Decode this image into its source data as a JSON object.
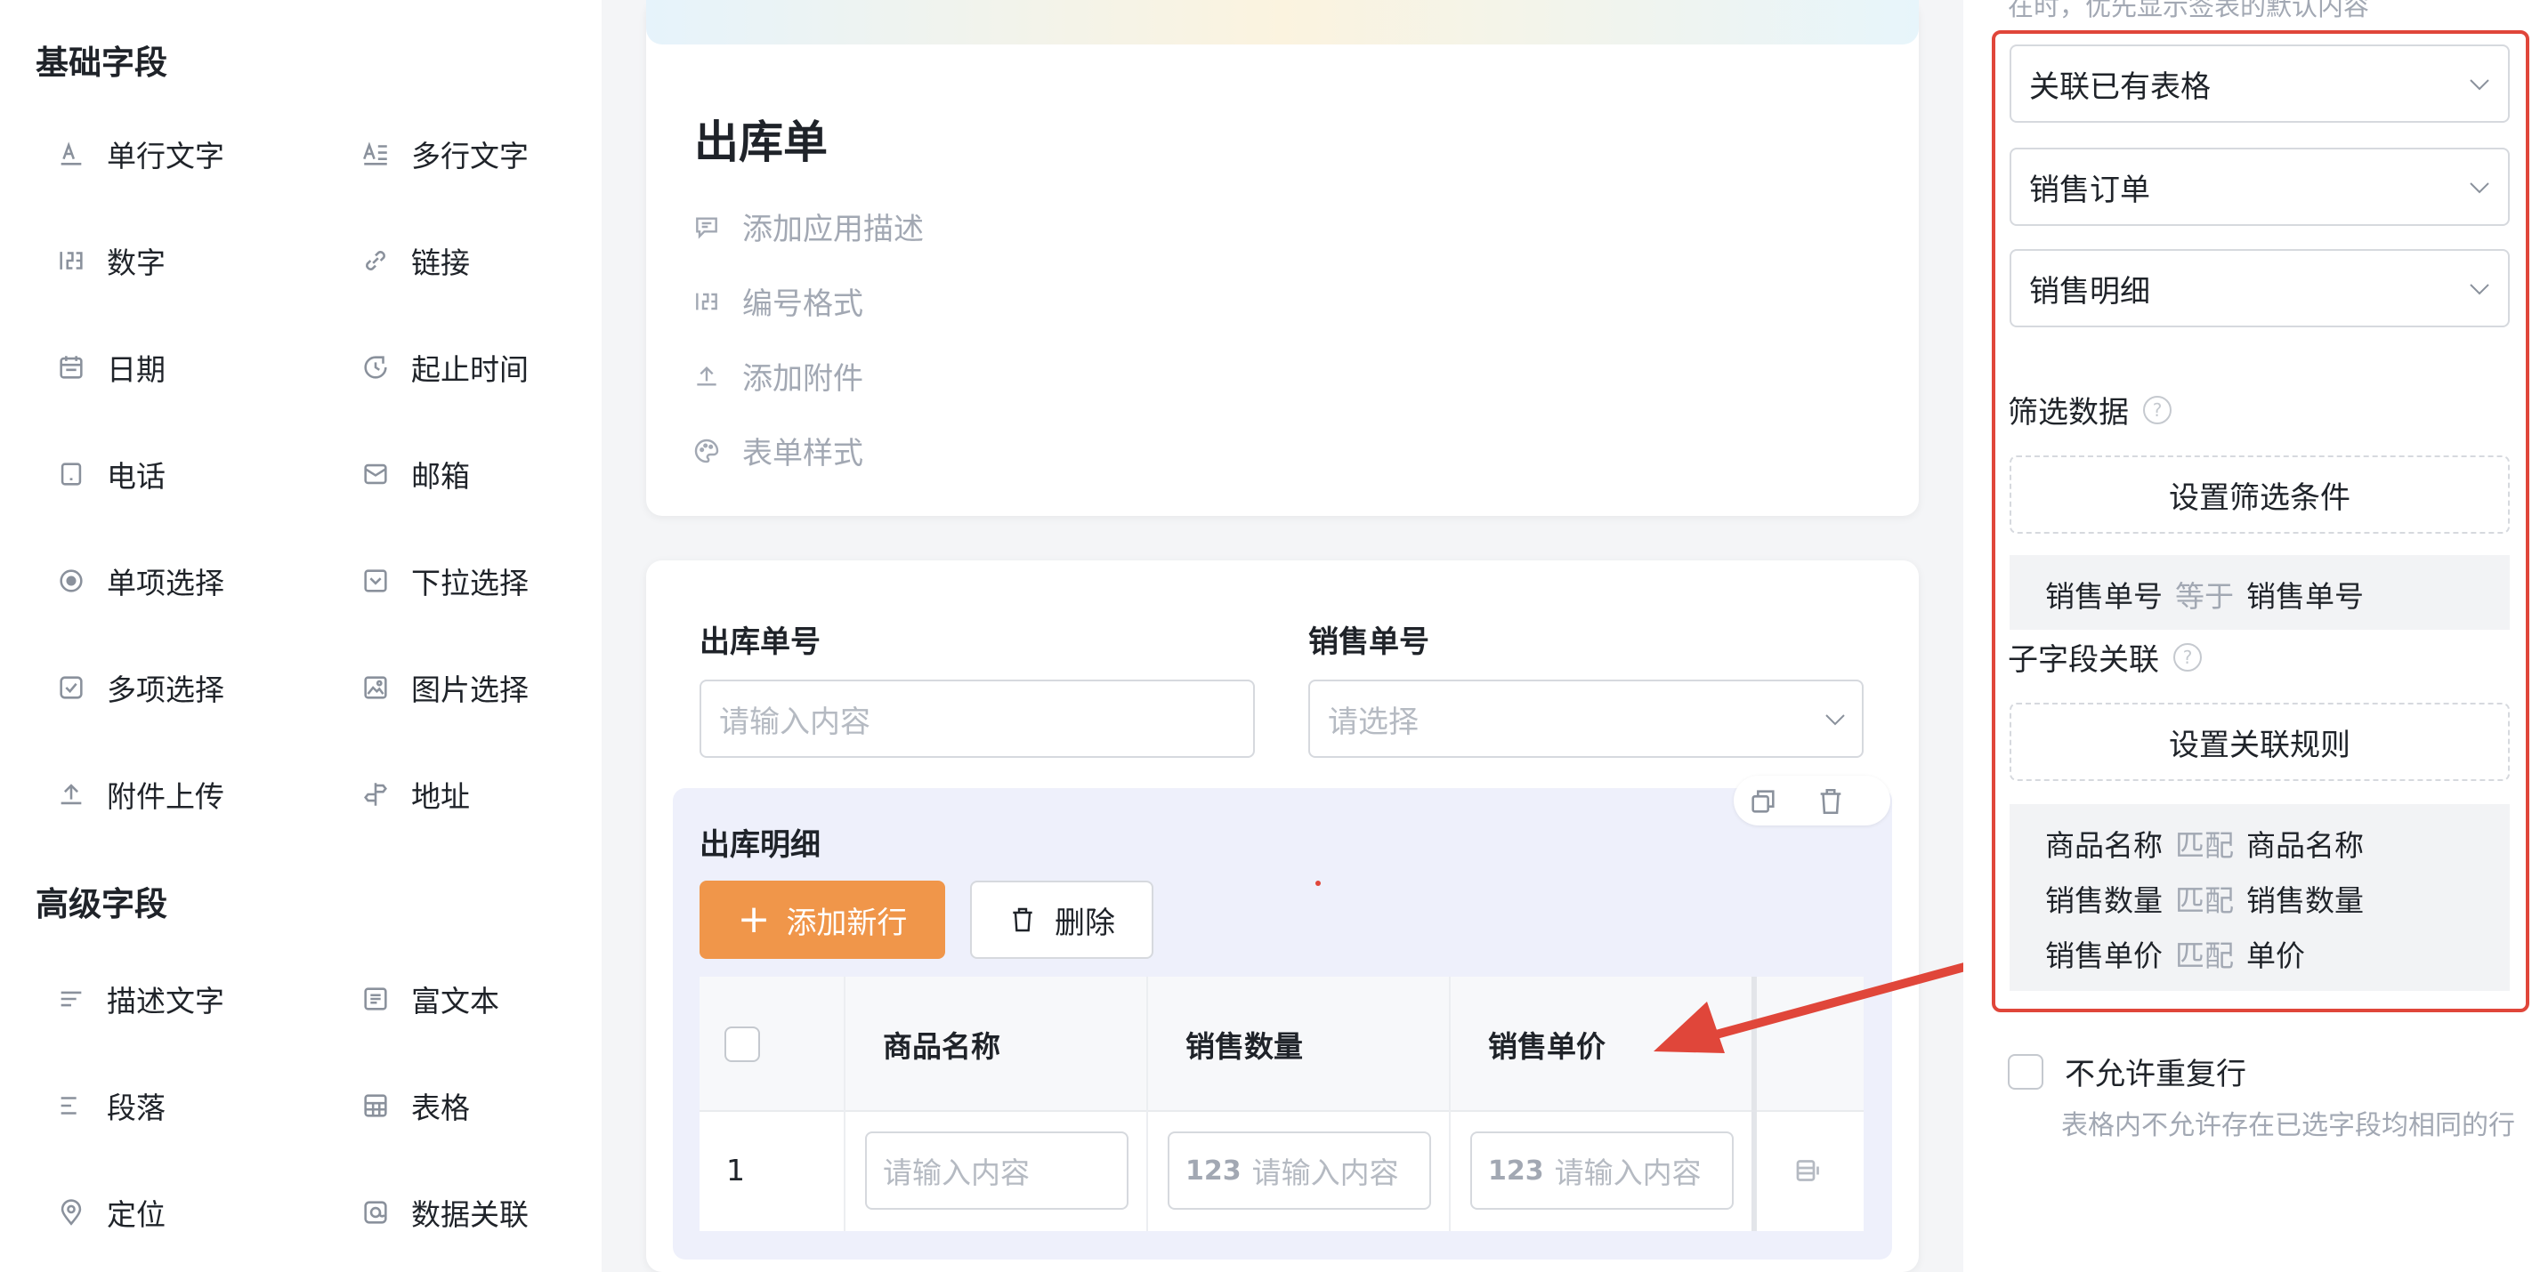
{
  "palette": {
    "basic_title": "基础字段",
    "advanced_title": "高级字段",
    "basic_items": [
      {
        "label": "单行文字",
        "icon": "single-line-text-icon"
      },
      {
        "label": "多行文字",
        "icon": "multi-line-text-icon"
      },
      {
        "label": "数字",
        "icon": "number-icon"
      },
      {
        "label": "链接",
        "icon": "link-icon"
      },
      {
        "label": "日期",
        "icon": "date-icon"
      },
      {
        "label": "起止时间",
        "icon": "time-range-icon"
      },
      {
        "label": "电话",
        "icon": "phone-icon"
      },
      {
        "label": "邮箱",
        "icon": "mail-icon"
      },
      {
        "label": "单项选择",
        "icon": "radio-icon"
      },
      {
        "label": "下拉选择",
        "icon": "dropdown-icon"
      },
      {
        "label": "多项选择",
        "icon": "checkbox-icon"
      },
      {
        "label": "图片选择",
        "icon": "image-icon"
      },
      {
        "label": "附件上传",
        "icon": "upload-icon"
      },
      {
        "label": "地址",
        "icon": "address-icon"
      }
    ],
    "advanced_items": [
      {
        "label": "描述文字",
        "icon": "description-icon"
      },
      {
        "label": "富文本",
        "icon": "rich-text-icon"
      },
      {
        "label": "段落",
        "icon": "paragraph-icon"
      },
      {
        "label": "表格",
        "icon": "table-icon"
      },
      {
        "label": "定位",
        "icon": "location-icon"
      },
      {
        "label": "数据关联",
        "icon": "data-link-icon"
      }
    ]
  },
  "form": {
    "title": "出库单",
    "meta": [
      {
        "label": "添加应用描述",
        "icon": "comment-icon"
      },
      {
        "label": "编号格式",
        "icon": "number-format-icon"
      },
      {
        "label": "添加附件",
        "icon": "upload-icon"
      },
      {
        "label": "表单样式",
        "icon": "palette-icon"
      }
    ],
    "outbound_no_label": "出库单号",
    "outbound_no_placeholder": "请输入内容",
    "sales_no_label": "销售单号",
    "sales_no_placeholder": "请选择",
    "subform": {
      "title": "出库明细",
      "add_button": "添加新行",
      "delete_button": "删除",
      "columns": [
        "商品名称",
        "销售数量",
        "销售单价"
      ],
      "row_index": "1",
      "cell_placeholder": "请输入内容"
    }
  },
  "panel": {
    "hint": "在时，优先显示签表的默认内容",
    "select_1": "关联已有表格",
    "select_2": "销售订单",
    "select_3": "销售明细",
    "filter_label": "筛选数据",
    "filter_button": "设置筛选条件",
    "filter_rule": {
      "left": "销售单号",
      "op": "等于",
      "right": "销售单号"
    },
    "subfield_label": "子字段关联",
    "subfield_button": "设置关联规则",
    "mappings": [
      {
        "left": "商品名称",
        "op": "匹配",
        "right": "商品名称"
      },
      {
        "left": "销售数量",
        "op": "匹配",
        "right": "销售数量"
      },
      {
        "left": "销售单价",
        "op": "匹配",
        "right": "单价"
      }
    ],
    "no_duplicate_label": "不允许重复行",
    "no_duplicate_desc": "表格内不允许存在已选字段均相同的行"
  },
  "colors": {
    "accent_orange": "#f0964a",
    "highlight_red": "#e0463a",
    "canvas_bg": "#f4f5f7"
  }
}
